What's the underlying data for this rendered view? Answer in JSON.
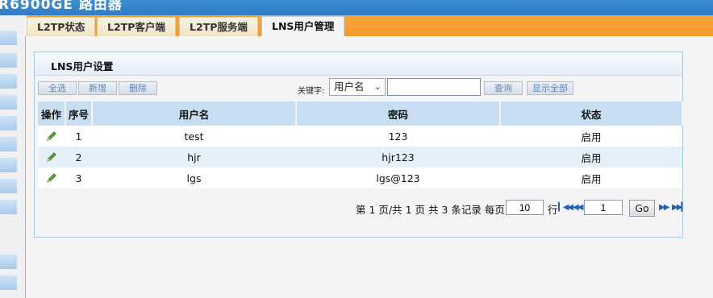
{
  "window": {
    "title": "R6900GE 路由器"
  },
  "tabs": [
    {
      "label": "L2TP状态"
    },
    {
      "label": "L2TP客户端"
    },
    {
      "label": "L2TP服务端"
    },
    {
      "label": "LNS用户管理",
      "active": true
    }
  ],
  "panel": {
    "title": "LNS用户设置",
    "toolbar": {
      "select_all": "全选",
      "add": "新增",
      "delete": "删除",
      "keyword_label": "关键字:",
      "keyword_field": "用户名",
      "keyword_value": "",
      "search": "查询",
      "show_all": "显示全部"
    },
    "table": {
      "headers": [
        "操作",
        "序号",
        "用户名",
        "密码",
        "状态"
      ],
      "rows": [
        {
          "index": "1",
          "username": "test",
          "password": "123",
          "status": "启用",
          "action_icon": "edit-pencil-icon"
        },
        {
          "index": "2",
          "username": "hjr",
          "password": "hjr123",
          "status": "启用",
          "action_icon": "edit-pencil-icon"
        },
        {
          "index": "3",
          "username": "lgs",
          "password": "lgs@123",
          "status": "启用",
          "action_icon": "edit-pencil-icon"
        }
      ]
    },
    "pager": {
      "summary": "第 1 页/共 1 页 共 3 条记录 每页",
      "per_page": "10",
      "unit": "行",
      "page_input": "1",
      "go": "Go",
      "first_icon": "first-page-icon",
      "prev_icon": "prev-page-icon",
      "next_icon": "next-page-icon",
      "last_icon": "last-page-icon"
    }
  },
  "colors": {
    "header_blue": "#2f7cc4",
    "tab_orange": "#f39a2a",
    "table_header": "#c7ddf1",
    "row_alt": "#e6f0fa",
    "button_text": "#5b86b8"
  }
}
